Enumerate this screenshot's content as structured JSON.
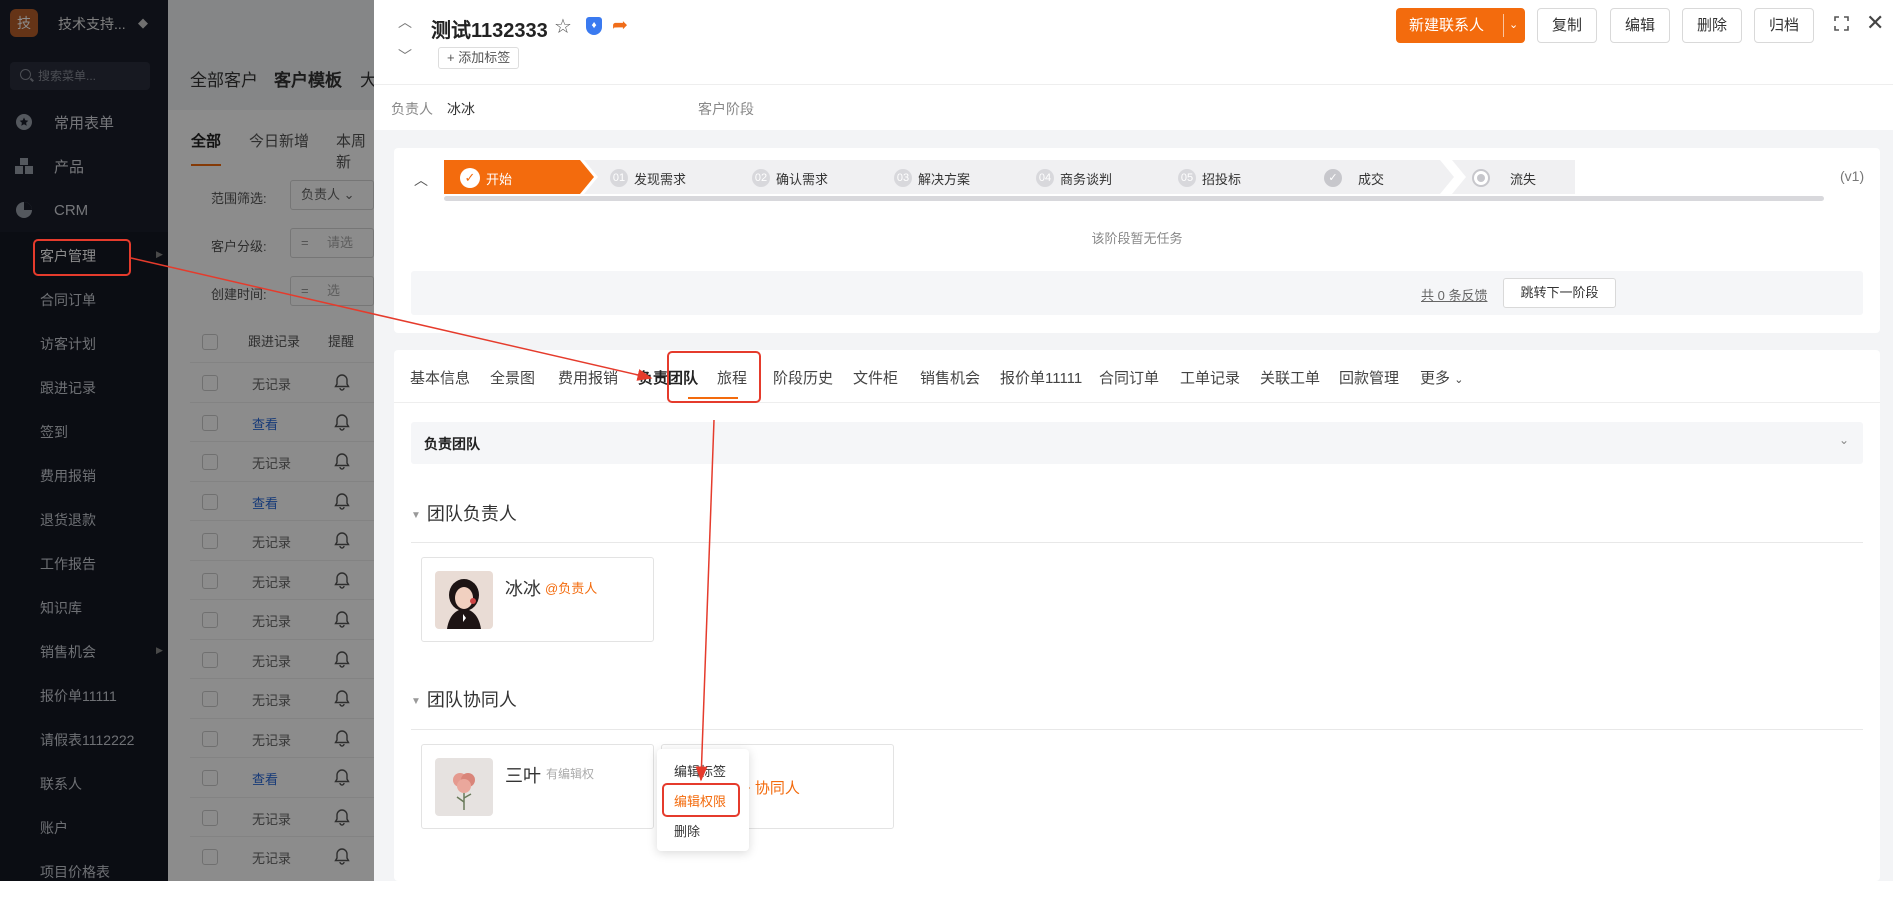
{
  "sidebar": {
    "logo_char": "技",
    "workspace": "技术支持...",
    "search_placeholder": "搜索菜单...",
    "sections": [
      {
        "label": "常用表单",
        "icon": "star-icon"
      },
      {
        "label": "产品",
        "icon": "cubes-icon"
      },
      {
        "label": "CRM",
        "icon": "pie-icon"
      }
    ],
    "items": [
      "客户管理",
      "合同订单",
      "访客计划",
      "跟进记录",
      "签到",
      "费用报销",
      "退货退款",
      "工作报告",
      "知识库",
      "销售机会",
      "报价单11111",
      "请假表1112222",
      "联系人",
      "账户",
      "项目价格表"
    ]
  },
  "list": {
    "top_tabs": [
      "全部客户",
      "客户模板",
      "大"
    ],
    "sub_tabs": [
      "全部",
      "今日新增",
      "本周新"
    ],
    "filters": [
      {
        "label": "范围筛选:",
        "value": "负责人"
      },
      {
        "label": "客户分级:",
        "value": "请选"
      },
      {
        "label": "创建时间:",
        "value": "选"
      }
    ],
    "columns": [
      "跟进记录",
      "提醒"
    ],
    "rows": [
      "无记录",
      "查看",
      "无记录",
      "查看",
      "无记录",
      "无记录",
      "无记录",
      "无记录",
      "无记录",
      "无记录",
      "查看",
      "无记录",
      "无记录"
    ]
  },
  "panel": {
    "title": "测试1132333",
    "add_tag": "+ 添加标签",
    "buttons": {
      "new_contact": "新建联系人",
      "copy": "复制",
      "edit": "编辑",
      "delete": "删除",
      "archive": "归档"
    },
    "owner_label": "负责人",
    "owner_value": "冰冰",
    "stage_label": "客户阶段",
    "stages": [
      {
        "label": "开始",
        "marker": "✓"
      },
      {
        "label": "发现需求",
        "marker": "01"
      },
      {
        "label": "确认需求",
        "marker": "02"
      },
      {
        "label": "解决方案",
        "marker": "03"
      },
      {
        "label": "商务谈判",
        "marker": "04"
      },
      {
        "label": "招投标",
        "marker": "05"
      },
      {
        "label": "成交",
        "marker": "✓"
      },
      {
        "label": "流失",
        "marker": ""
      }
    ],
    "version": "(v1)",
    "no_task": "该阶段暂无任务",
    "feedback": "共 0 条反馈",
    "next_stage": "跳转下一阶段",
    "tabs": [
      "基本信息",
      "全景图",
      "费用报销",
      "负责团队",
      "旅程",
      "阶段历史",
      "文件柜",
      "销售机会",
      "报价单11111",
      "合同订单",
      "工单记录",
      "关联工单",
      "回款管理",
      "更多"
    ],
    "active_tab": "负责团队",
    "section_title": "负责团队",
    "group_leader": "团队负责人",
    "group_collab": "团队协同人",
    "leader": {
      "name": "冰冰",
      "role": "@负责人"
    },
    "collaborator": {
      "name": "三叶",
      "perm": "有编辑权"
    },
    "add_collab": "+ 协同人",
    "context_menu": [
      "编辑标签",
      "编辑权限",
      "删除"
    ]
  },
  "colors": {
    "accent": "#f36b0d",
    "annotation": "#e53b2c",
    "sidebar_bg": "#1a1e2b"
  }
}
